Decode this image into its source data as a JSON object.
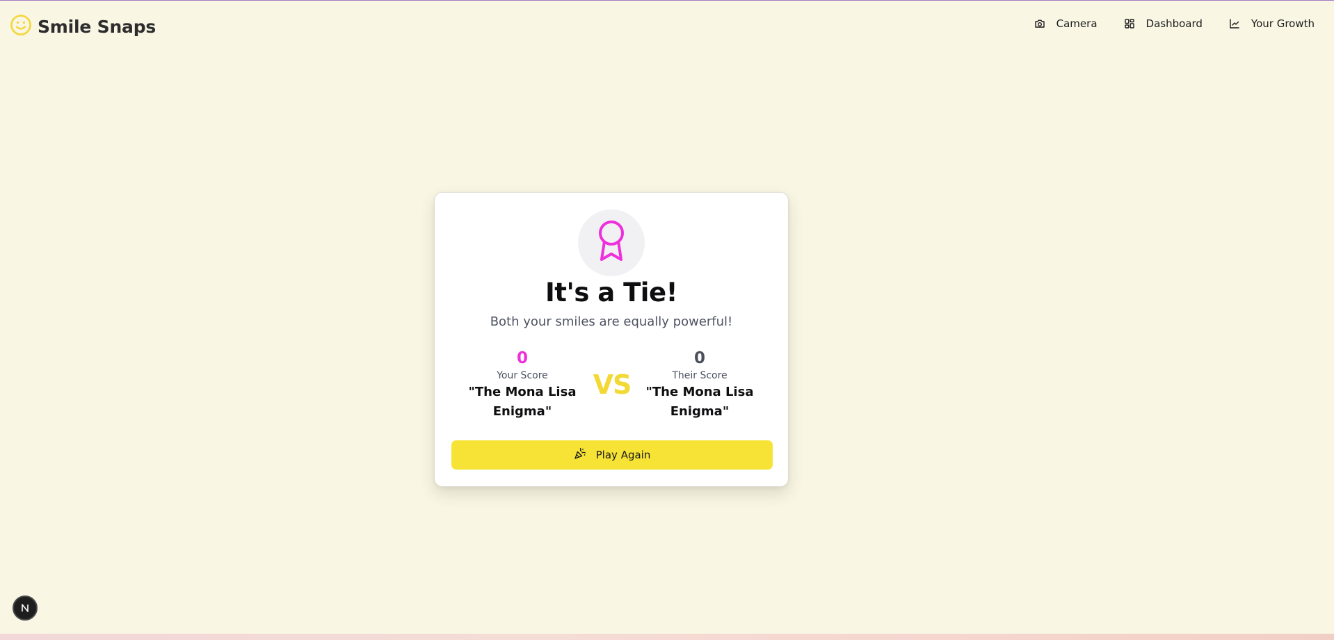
{
  "app": {
    "name": "Smile Snaps",
    "logo_icon": "smiley-icon",
    "accent_color": "#f3d735"
  },
  "nav": [
    {
      "label": "Camera",
      "icon": "camera-icon"
    },
    {
      "label": "Dashboard",
      "icon": "dashboard-icon"
    },
    {
      "label": "Your Growth",
      "icon": "chart-line-icon"
    }
  ],
  "result": {
    "icon": "award-ribbon-icon",
    "title": "It's a Tie!",
    "subtitle": "Both your smiles are equally powerful!",
    "vs_label": "VS",
    "player": {
      "score": "0",
      "label": "Your Score",
      "name": "\"The Mona Lisa Enigma\"",
      "color": "#ee2fdc"
    },
    "opponent": {
      "score": "0",
      "label": "Their Score",
      "name": "\"The Mona Lisa Enigma\"",
      "color": "#4b4f5c"
    },
    "play_again": {
      "label": "Play Again",
      "icon": "party-popper-icon"
    }
  },
  "dev_badge": {
    "letter": "N"
  }
}
